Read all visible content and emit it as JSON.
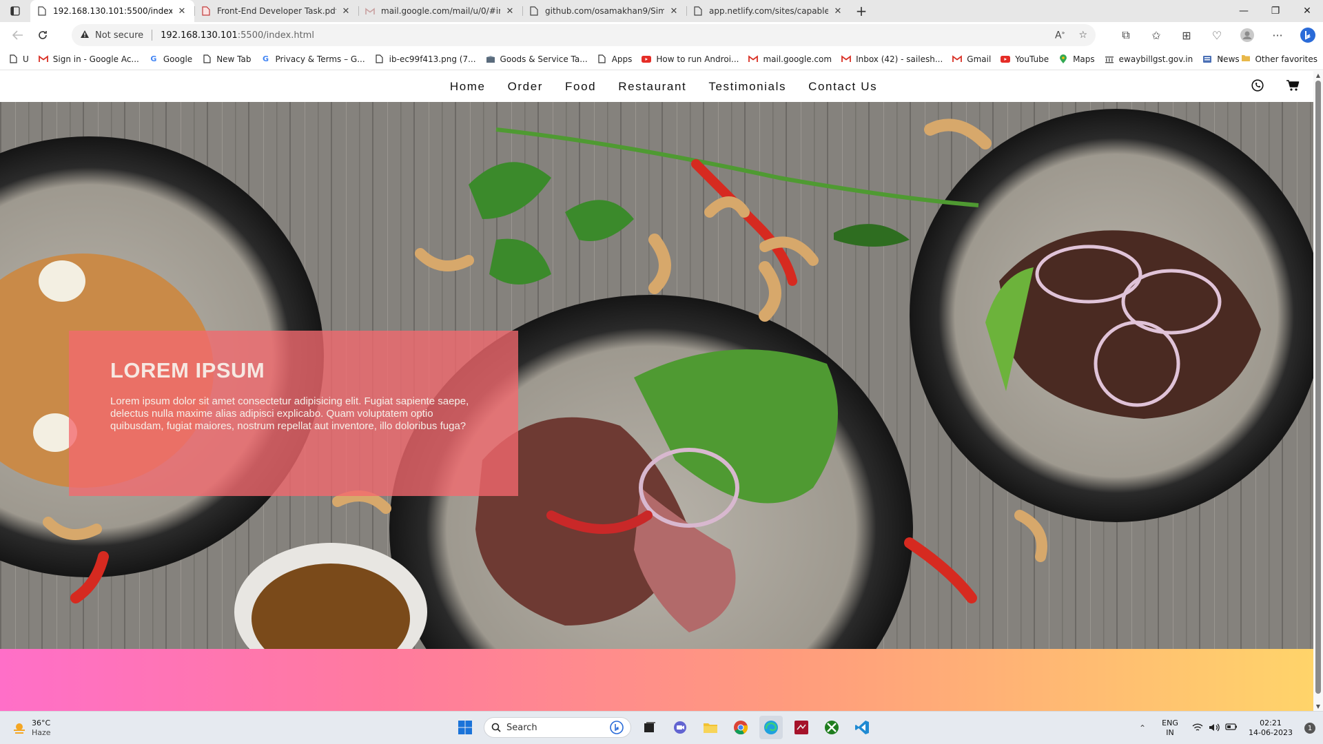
{
  "browser": {
    "tabs": [
      {
        "title": "192.168.130.101:5500/index.html",
        "active": true,
        "icon": "page-icon"
      },
      {
        "title": "Front-End Developer Task.pdf",
        "active": false,
        "icon": "pdf-icon"
      },
      {
        "title": "mail.google.com/mail/u/0/#inbo",
        "active": false,
        "icon": "gmail-icon"
      },
      {
        "title": "github.com/osamakhan9/Simplo",
        "active": false,
        "icon": "page-icon"
      },
      {
        "title": "app.netlify.com/sites/capable-sfc",
        "active": false,
        "icon": "page-icon"
      }
    ],
    "address": {
      "security_label": "Not secure",
      "url_host": "192.168.130.101",
      "url_rest": ":5500/index.html"
    },
    "bookmarks": [
      {
        "label": "U",
        "icon": "page-icon"
      },
      {
        "label": "Sign in - Google Ac...",
        "icon": "gmail-icon"
      },
      {
        "label": "Google",
        "icon": "google-icon"
      },
      {
        "label": "New Tab",
        "icon": "page-icon"
      },
      {
        "label": "Privacy & Terms – G...",
        "icon": "google-icon"
      },
      {
        "label": "ib-ec99f413.png (7...",
        "icon": "page-icon"
      },
      {
        "label": "Goods & Service Ta...",
        "icon": "gst-icon"
      },
      {
        "label": "Apps",
        "icon": "page-icon"
      },
      {
        "label": "How to run Androi...",
        "icon": "youtube-icon"
      },
      {
        "label": "mail.google.com",
        "icon": "gmail-icon"
      },
      {
        "label": "Inbox (42) - sailesh...",
        "icon": "gmail-icon"
      },
      {
        "label": "Gmail",
        "icon": "gmail-icon"
      },
      {
        "label": "YouTube",
        "icon": "youtube-icon"
      },
      {
        "label": "Maps",
        "icon": "maps-icon"
      },
      {
        "label": "ewaybillgst.gov.in",
        "icon": "gov-icon"
      },
      {
        "label": "News",
        "icon": "news-icon"
      }
    ],
    "other_favorites": "Other favorites"
  },
  "site": {
    "nav": [
      "Home",
      "Order",
      "Food",
      "Restaurant",
      "Testimonials",
      "Contact Us"
    ],
    "hero": {
      "heading": "LOREM IPSUM",
      "body": "Lorem ipsum dolor sit amet consectetur adipisicing elit. Fugiat sapiente saepe, delectus nulla maxime alias adipisci explicabo. Quam voluptatem optio quibusdam, fugiat maiores, nostrum repellat aut inventore, illo doloribus fuga?",
      "colors": {
        "overlay": "#f4696e",
        "band_start": "#ff6fc8",
        "band_end": "#ffd46a"
      }
    }
  },
  "taskbar": {
    "weather_temp": "36°C",
    "weather_desc": "Haze",
    "search_placeholder": "Search",
    "lang_top": "ENG",
    "lang_bottom": "IN",
    "time": "02:21",
    "date": "14-06-2023",
    "notification_count": "1"
  }
}
